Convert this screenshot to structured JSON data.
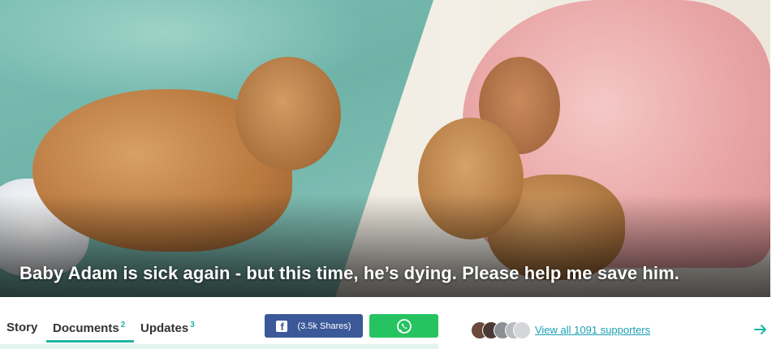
{
  "hero": {
    "title": "Baby Adam is sick again - but this time, he’s dying. Please help me save him."
  },
  "tabs": [
    {
      "label": "Story",
      "count": ""
    },
    {
      "label": "Documents",
      "count": "2"
    },
    {
      "label": "Updates",
      "count": "3"
    }
  ],
  "active_tab": "Documents",
  "share": {
    "facebook_label": "(3.5k Shares)",
    "facebook_icon": "facebook-icon",
    "whatsapp_icon": "whatsapp-icon"
  },
  "supporters": {
    "link_text": "View all 1091 supporters",
    "arrow_icon": "arrow-right-icon"
  },
  "colors": {
    "accent": "#1fb5a3",
    "facebook": "#3b5998",
    "whatsapp": "#25c461",
    "link": "#1a9fb5"
  }
}
